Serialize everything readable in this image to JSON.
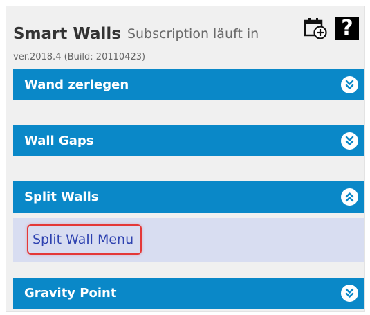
{
  "header": {
    "app_title": "Smart Walls",
    "subscription_text": "Subscription läuft in",
    "calendar_icon": "calendar-add-icon",
    "help_icon": "help-icon",
    "help_glyph": "?"
  },
  "version": "ver.2018.4 (Build: 20110423)",
  "sections": [
    {
      "label": "Wand zerlegen",
      "state": "collapsed",
      "toggle_icon": "chevron-double-down-icon"
    },
    {
      "label": "Wall Gaps",
      "state": "collapsed",
      "toggle_icon": "chevron-double-down-icon"
    },
    {
      "label": "Split Walls",
      "state": "expanded",
      "toggle_icon": "chevron-double-up-icon",
      "items": [
        {
          "label": "Split Wall Menu",
          "highlighted": true
        }
      ]
    },
    {
      "label": "Gravity Point",
      "state": "collapsed",
      "toggle_icon": "chevron-double-down-icon"
    }
  ],
  "colors": {
    "section_bar": "#0a88c8",
    "section_body": "#d8ddf1",
    "link": "#2e42b0",
    "highlight": "#e43838",
    "panel_bg": "#f0f0f0"
  }
}
